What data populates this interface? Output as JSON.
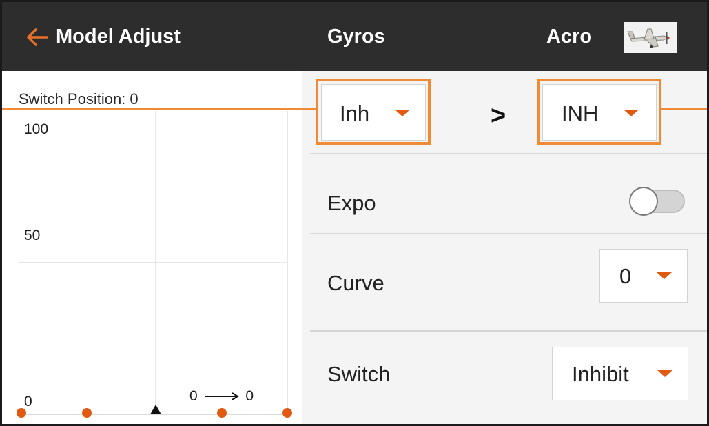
{
  "header": {
    "back_label": "Model Adjust",
    "center_title": "Gyros",
    "model_type": "Acro",
    "thumbnail_icon": "airplane-icon",
    "back_icon": "arrow-left-icon"
  },
  "graph": {
    "switch_position_label": "Switch Position: 0",
    "y_labels": [
      "100",
      "50",
      "0"
    ],
    "transition_from": "0",
    "transition_to": "0",
    "arrow_icon": "long-arrow-right-icon"
  },
  "gain_selectors": {
    "left_value": "Inh",
    "separator": ">",
    "right_value": "INH"
  },
  "settings": {
    "expo_label": "Expo",
    "expo_enabled": false,
    "curve_label": "Curve",
    "curve_value": "0",
    "switch_label": "Switch",
    "switch_value": "Inhibit"
  },
  "colors": {
    "header_bg": "#2d2d2d",
    "accent": "#e05a12",
    "callout": "#ef8a37",
    "panel_bg": "#f4f4f4"
  }
}
